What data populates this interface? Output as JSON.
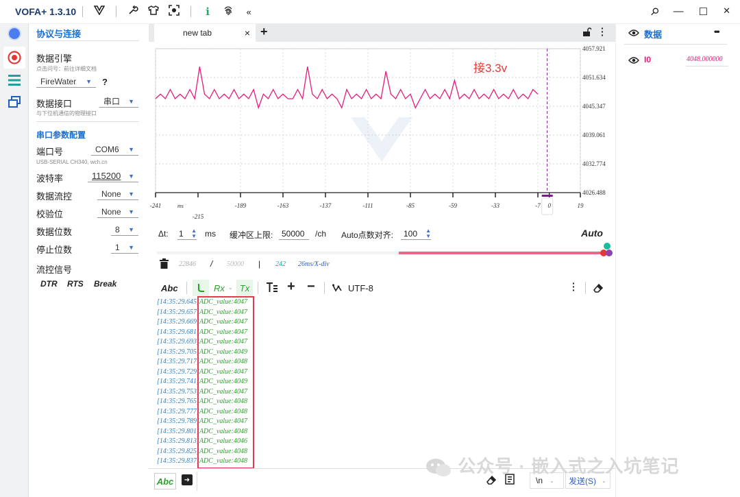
{
  "app": {
    "title": "VOFA+ 1.3.10"
  },
  "window": {
    "pin": "⚲",
    "minimize": "—",
    "maximize": "☐",
    "close": "✕"
  },
  "sidebar": {
    "title": "协议与连接",
    "engine_label": "数据引擎",
    "engine_sub": "点击问号：前往详细文档",
    "engine_value": "FireWater",
    "help": "?",
    "interface_label": "数据接口",
    "interface_sub": "与下位机通信的物理接口",
    "interface_value": "串口",
    "serial_section": "串口参数配置",
    "port_label": "端口号",
    "port_value": "COM6",
    "port_sub": "USB-SERIAL CH340, wch.cn",
    "baud_label": "波特率",
    "baud_value": "115200",
    "flow_label": "数据流控",
    "flow_value": "None",
    "parity_label": "校验位",
    "parity_value": "None",
    "databits_label": "数据位数",
    "databits_value": "8",
    "stopbits_label": "停止位数",
    "stopbits_value": "1",
    "flowsig_label": "流控信号",
    "dtr": "DTR",
    "rts": "RTS",
    "brk": "Break"
  },
  "tab": {
    "name": "new tab",
    "close": "×",
    "add": "+"
  },
  "chart_data": {
    "type": "line",
    "annotation": "接3.3v",
    "y_ticks": [
      "4057.921",
      "4051.634",
      "4045.347",
      "4039.061",
      "4032.774",
      "4026.488"
    ],
    "y_range": [
      4026.488,
      4057.921
    ],
    "x_ticks_top": [
      "-241",
      "-189",
      "-163",
      "-137",
      "-111",
      "-85",
      "-59",
      "-33",
      "-7",
      "0",
      "19"
    ],
    "x_ticks_bottom": [
      "-215"
    ],
    "x_unit": "ms",
    "x_range": [
      -241,
      19
    ],
    "series": [
      {
        "color": "#e6197d",
        "x": [
          -241,
          -238,
          -235,
          -232,
          -229,
          -226,
          -223,
          -220,
          -217,
          -214,
          -211,
          -208,
          -205,
          -202,
          -199,
          -196,
          -193,
          -190,
          -187,
          -184,
          -181,
          -178,
          -175,
          -172,
          -169,
          -166,
          -163,
          -160,
          -157,
          -154,
          -151,
          -148,
          -145,
          -142,
          -139,
          -136,
          -133,
          -130,
          -127,
          -124,
          -121,
          -118,
          -115,
          -112,
          -109,
          -106,
          -103,
          -100,
          -97,
          -94,
          -91,
          -88,
          -85,
          -82,
          -79,
          -76,
          -73,
          -70,
          -67,
          -64,
          -61,
          -58,
          -55,
          -52,
          -49,
          -46,
          -43,
          -40,
          -37,
          -34,
          -31,
          -28,
          -25,
          -22,
          -19,
          -16,
          -13,
          -10,
          -7
        ],
        "y": [
          4047,
          4048,
          4047,
          4049,
          4047,
          4048,
          4047,
          4049,
          4047,
          4054,
          4048,
          4047,
          4049,
          4047,
          4048,
          4047,
          4049,
          4047,
          4048,
          4047,
          4049,
          4045,
          4048,
          4047,
          4049,
          4047,
          4048,
          4047,
          4047,
          4049,
          4047,
          4054,
          4048,
          4047,
          4049,
          4047,
          4048,
          4047,
          4045,
          4049,
          4047,
          4048,
          4047,
          4049,
          4047,
          4048,
          4047,
          4053,
          4048,
          4047,
          4049,
          4047,
          4048,
          4045,
          4047,
          4049,
          4047,
          4048,
          4047,
          4049,
          4047,
          4051,
          4047,
          4048,
          4047,
          4049,
          4047,
          4048,
          4047,
          4049,
          4047,
          4048,
          4047,
          4049,
          4047,
          4048,
          4047,
          4049,
          4048
        ]
      }
    ]
  },
  "controls": {
    "dt_label": "Δt:",
    "dt_value": "1",
    "dt_unit": "ms",
    "buffer_label": "缓冲区上限:",
    "buffer_value": "50000",
    "buffer_unit": "/ch",
    "align_label": "Auto点数对齐:",
    "align_value": "100",
    "auto": "Auto",
    "count": "22846",
    "slash": "/",
    "limit": "50000",
    "pipe": "|",
    "points": "242",
    "div": "26ms/X-div",
    "scroll_fraction": 0.54
  },
  "terminal": {
    "abc": "Abc",
    "rx": "Rx",
    "tx": "Tx",
    "plus": "+",
    "minus": "−",
    "encoding": "UTF-8",
    "lines": [
      {
        "t": "[14:35:29.645]",
        "v": "ADC_value:4047"
      },
      {
        "t": "[14:35:29.657]",
        "v": "ADC_value:4047"
      },
      {
        "t": "[14:35:29.669]",
        "v": "ADC_value:4047"
      },
      {
        "t": "[14:35:29.681]",
        "v": "ADC_value:4047"
      },
      {
        "t": "[14:35:29.693]",
        "v": "ADC_value:4047"
      },
      {
        "t": "[14:35:29.705]",
        "v": "ADC_value:4049"
      },
      {
        "t": "[14:35:29.717]",
        "v": "ADC_value:4048"
      },
      {
        "t": "[14:35:29.729]",
        "v": "ADC_value:4047"
      },
      {
        "t": "[14:35:29.741]",
        "v": "ADC_value:4049"
      },
      {
        "t": "[14:35:29.753]",
        "v": "ADC_value:4047"
      },
      {
        "t": "[14:35:29.765]",
        "v": "ADC_value:4048"
      },
      {
        "t": "[14:35:29.777]",
        "v": "ADC_value:4048"
      },
      {
        "t": "[14:35:29.789]",
        "v": "ADC_value:4047"
      },
      {
        "t": "[14:35:29.801]",
        "v": "ADC_value:4048"
      },
      {
        "t": "[14:35:29.813]",
        "v": "ADC_value:4046"
      },
      {
        "t": "[14:35:29.825]",
        "v": "ADC_value:4048"
      },
      {
        "t": "[14:35:29.837]",
        "v": "ADC_value:4048"
      }
    ]
  },
  "input": {
    "abc": "Abc",
    "newline": "\\n",
    "send": "发送(S)"
  },
  "rpanel": {
    "title": "数据",
    "menu": "•••",
    "ch_name": "I0",
    "ch_value": "4048.000000"
  },
  "watermark": "公众号 · 嵌入式之入坑笔记"
}
